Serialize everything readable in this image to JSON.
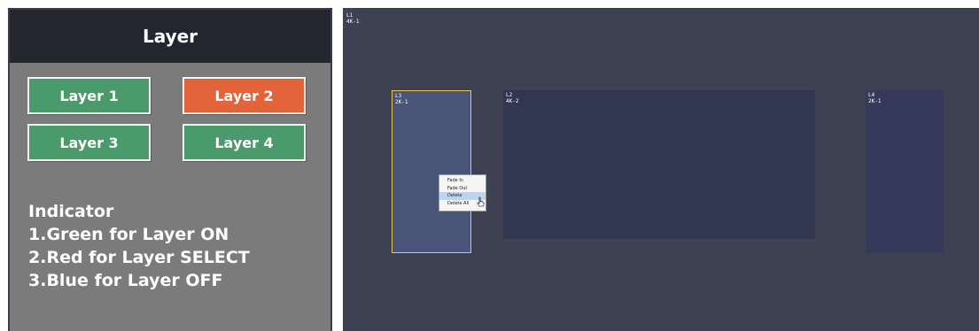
{
  "panel": {
    "title": "Layer",
    "buttons": [
      {
        "label": "Layer 1",
        "state": "on",
        "color": "#4a9a6b"
      },
      {
        "label": "Layer 2",
        "state": "select",
        "color": "#e3643b"
      },
      {
        "label": "Layer 3",
        "state": "on",
        "color": "#4a9a6b"
      },
      {
        "label": "Layer 4",
        "state": "on",
        "color": "#4a9a6b"
      }
    ],
    "indicator": {
      "heading": "Indicator",
      "lines": [
        "1.Green for Layer ON",
        "2.Red for Layer SELECT",
        "3.Blue for Layer OFF"
      ]
    }
  },
  "canvas": {
    "background_layer": {
      "id": "L1",
      "source": "4K-1"
    },
    "layers": [
      {
        "id": "L3",
        "source": "2K-1",
        "selected": true
      },
      {
        "id": "L2",
        "source": "4K-2",
        "selected": false
      },
      {
        "id": "L4",
        "source": "2K-1",
        "selected": false
      }
    ],
    "context_menu": {
      "items": [
        "Fade In",
        "Fade Out",
        "Delete",
        "Delete All"
      ],
      "highlighted": "Delete"
    }
  },
  "colors": {
    "panel_bg": "#7b7b7b",
    "header_bg": "#23262f",
    "canvas_bg": "#3e4152",
    "selected_outline": "#e7c85a",
    "menu_highlight": "#b9d5f3"
  }
}
